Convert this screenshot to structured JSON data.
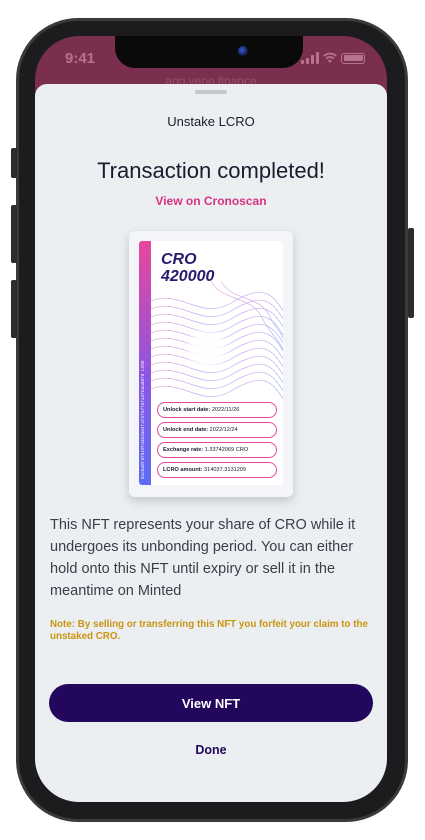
{
  "status_bar": {
    "time": "9:41"
  },
  "background_app": {
    "title": "app.veno.finance"
  },
  "sheet": {
    "title": "Unstake LCRO",
    "headline": "Transaction completed!",
    "explorer_link": "View on Cronoscan"
  },
  "nft": {
    "token": "CRO",
    "amount": "420000",
    "contract": "0xc5a9fd7519fd4b3ae4faf2f57fbfa3fbaa0dfd  LCRO",
    "rows": [
      {
        "label": "Unlock start date:",
        "value": "2022/11/26"
      },
      {
        "label": "Unlock end date:",
        "value": "2022/12/24"
      },
      {
        "label": "Exchange rate:",
        "value": "1.33742069 CRO"
      },
      {
        "label": "LCRO amount:",
        "value": "314037.3131209"
      }
    ]
  },
  "description": "This NFT represents your share of CRO while it undergoes its unbonding period. You can either hold onto this NFT until expiry or sell it in the meantime on Minted",
  "note": "Note: By selling or transferring this NFT you forfeit your claim to the unstaked CRO.",
  "actions": {
    "view_nft": "View NFT",
    "done": "Done"
  },
  "colors": {
    "accent_pink": "#d63384",
    "primary_button": "#22075c",
    "note_text": "#c89412",
    "backdrop": "#7b2f4e"
  },
  "icons": [
    "signal-icon",
    "wifi-icon",
    "battery-icon",
    "camera-icon"
  ]
}
